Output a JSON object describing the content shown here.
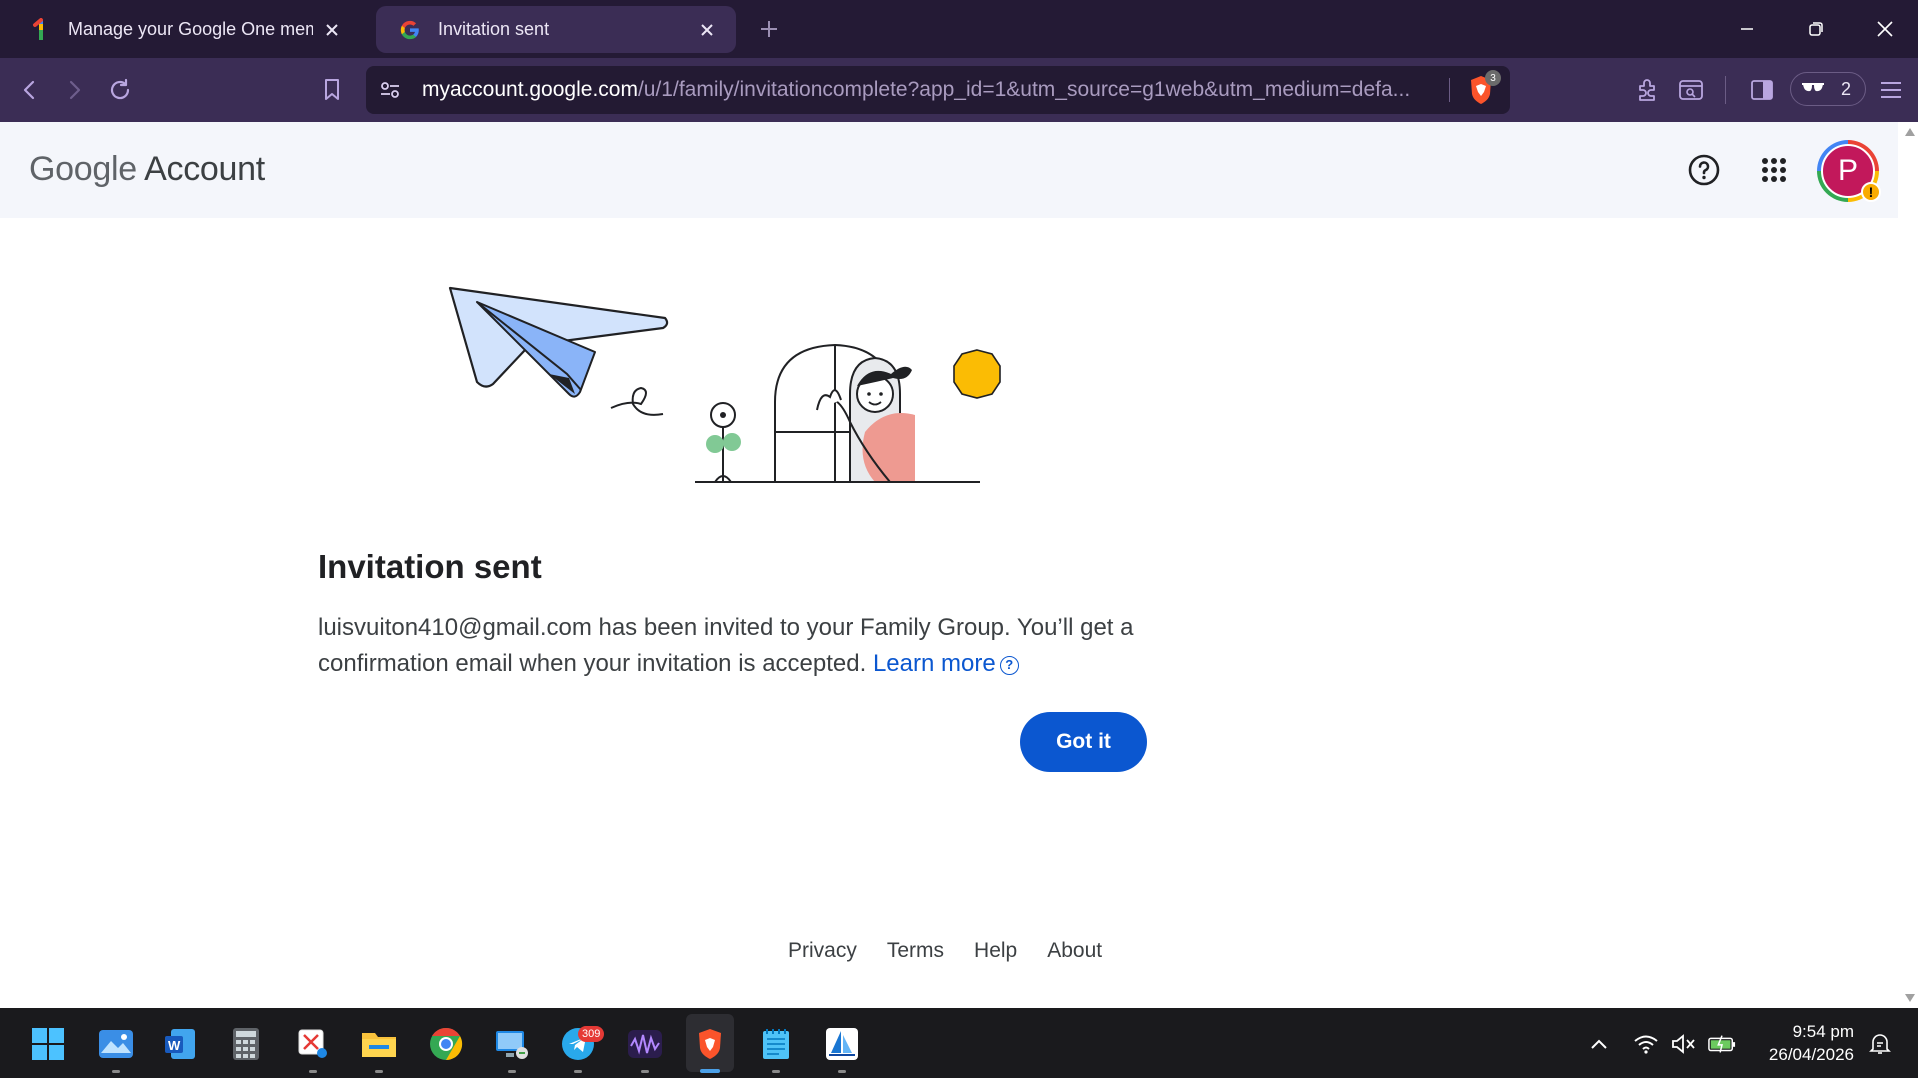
{
  "browser": {
    "tabs": [
      {
        "title": "Manage your Google One memb",
        "active": false,
        "favicon": "google-one-icon"
      },
      {
        "title": "Invitation sent",
        "active": true,
        "favicon": "google-g-icon"
      }
    ],
    "url_host": "myaccount.google.com",
    "url_rest": "/u/1/family/invitationcomplete?app_id=1&utm_source=g1web&utm_medium=defa...",
    "shield_count": "3",
    "private_tab_count": "2"
  },
  "header": {
    "logo_google": "Google",
    "logo_account": "Account",
    "avatar_letter": "P",
    "avatar_warning": "!"
  },
  "main": {
    "heading": "Invitation sent",
    "body": "luisvuiton410@gmail.com has been invited to your Family Group. You’ll get a confirmation email when your invitation is accepted.",
    "learn_more": "Learn more",
    "help_glyph": "?",
    "button": "Got it"
  },
  "footer": {
    "links": [
      "Privacy",
      "Terms",
      "Help",
      "About"
    ]
  },
  "taskbar": {
    "telegram_badge": "309",
    "time": "9:54 pm",
    "date": "26/04/2026"
  },
  "colors": {
    "accent": "#0b57d0",
    "browser_frame": "#241a35",
    "toolbar": "#3b2d55",
    "avatar": "#c2185b"
  }
}
